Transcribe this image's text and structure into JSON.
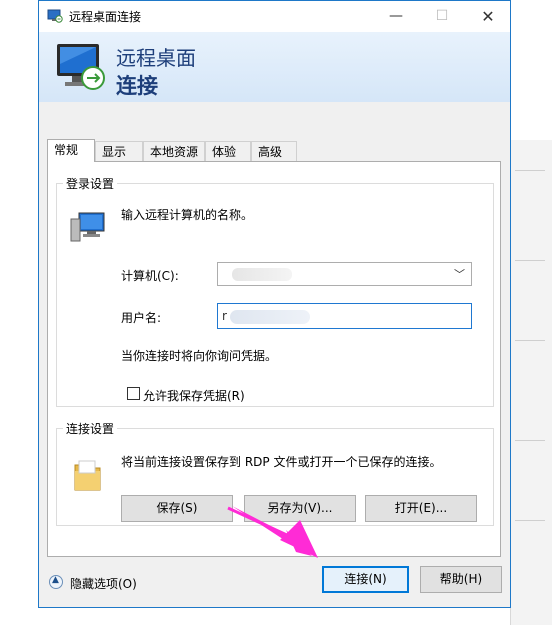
{
  "window": {
    "title": "远程桌面连接",
    "minimize_glyph": "—",
    "maximize_glyph": "☐",
    "close_glyph": "✕"
  },
  "banner": {
    "line1": "远程桌面",
    "line2": "连接"
  },
  "tabs": [
    {
      "label": "常规",
      "active": true
    },
    {
      "label": "显示",
      "active": false
    },
    {
      "label": "本地资源",
      "active": false
    },
    {
      "label": "体验",
      "active": false
    },
    {
      "label": "高级",
      "active": false
    }
  ],
  "login": {
    "legend": "登录设置",
    "prompt": "输入远程计算机的名称。",
    "computer_label": "计算机(C):",
    "computer_value": "",
    "username_label": "用户名:",
    "username_value": "r",
    "credentials_note": "当你连接时将向你询问凭据。",
    "save_credentials_label": "允许我保存凭据(R)",
    "save_credentials_checked": false
  },
  "connection": {
    "legend": "连接设置",
    "description": "将当前连接设置保存到 RDP 文件或打开一个已保存的连接。",
    "save_label": "保存(S)",
    "save_as_label": "另存为(V)...",
    "open_label": "打开(E)..."
  },
  "footer": {
    "hide_options_label": "隐藏选项(O)",
    "connect_label": "连接(N)",
    "help_label": "帮助(H)"
  },
  "icons": {
    "title": "remote-desktop-icon",
    "banner": "remote-desktop-monitor-icon",
    "computer": "computer-monitor-icon",
    "folder": "folder-icon",
    "collapse": "chevron-up-circle-icon",
    "dropdown": "chevron-down-icon",
    "annotation": "pink-arrow"
  },
  "colors": {
    "accent": "#0078d7",
    "banner_text": "#1d3e7a",
    "annotation_arrow": "#ff2bd6"
  }
}
